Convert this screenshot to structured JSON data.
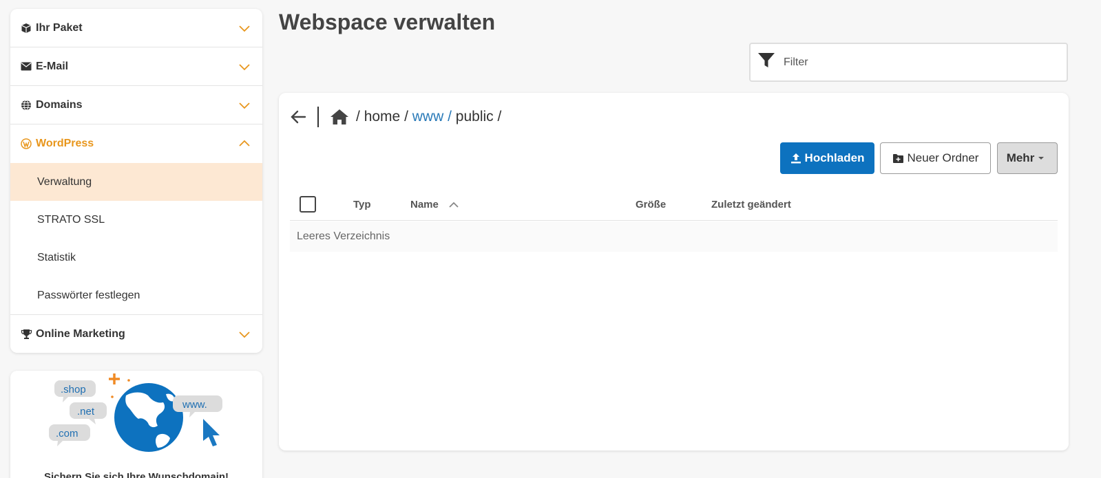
{
  "sidebar": {
    "sections": [
      {
        "label": "Ihr Paket",
        "icon": "package-icon"
      },
      {
        "label": "E-Mail",
        "icon": "envelope-icon"
      },
      {
        "label": "Domains",
        "icon": "globe-icon"
      },
      {
        "label": "WordPress",
        "icon": "wordpress-icon",
        "expanded": true,
        "items": [
          "Verwaltung",
          "STRATO SSL",
          "Statistik",
          "Passwörter festlegen"
        ],
        "selected_item": "Verwaltung"
      },
      {
        "label": "Online Marketing",
        "icon": "trophy-icon"
      }
    ]
  },
  "promo": {
    "bubbles": [
      ".shop",
      ".net",
      ".com",
      "www."
    ],
    "text": "Sichern Sie sich Ihre Wunschdomain!"
  },
  "main": {
    "title": "Webspace verwalten",
    "filter_placeholder": "Filter",
    "breadcrumb": {
      "prefix": "/",
      "segments": [
        "home",
        "www",
        "public"
      ],
      "separator": "/"
    },
    "buttons": {
      "upload": "Hochladen",
      "new_folder": "Neuer Ordner",
      "more": "Mehr"
    },
    "table": {
      "columns": [
        "Typ",
        "Name",
        "Größe",
        "Zuletzt geändert"
      ],
      "sorted_by": "Name",
      "sort_direction": "asc",
      "empty_text": "Leeres Verzeichnis"
    }
  },
  "colors": {
    "accent": "#e8961c",
    "primary": "#0d72bf",
    "link": "#2a7ab8",
    "selected_bg": "#fde8d3"
  }
}
